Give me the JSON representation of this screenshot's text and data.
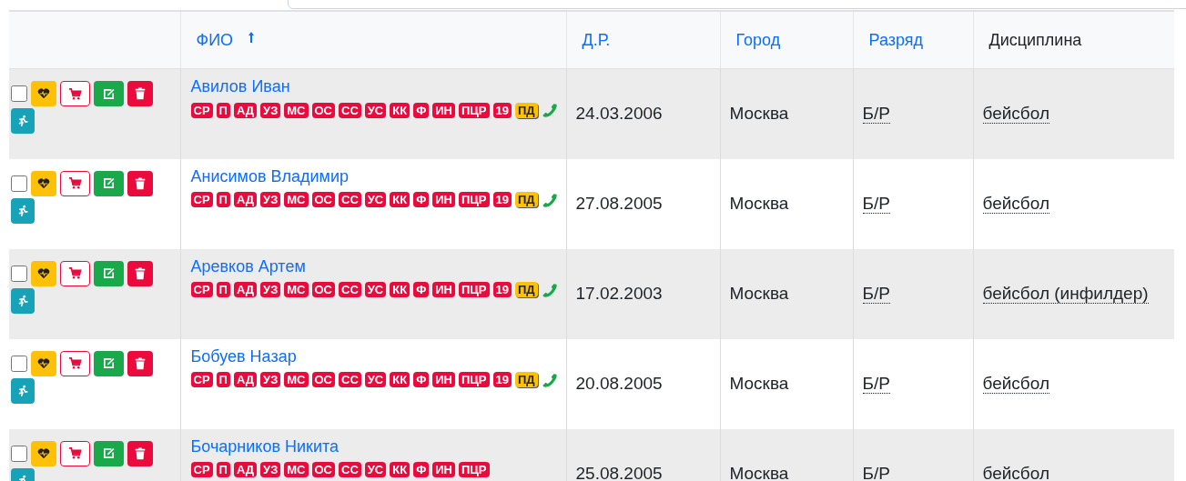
{
  "columns": [
    {
      "label": "ФИО",
      "sortable": true,
      "sorted": true
    },
    {
      "label": "Д.Р.",
      "sortable": true,
      "sorted": false
    },
    {
      "label": "Город",
      "sortable": true,
      "sorted": false
    },
    {
      "label": "Разряд",
      "sortable": true,
      "sorted": false
    },
    {
      "label": "Дисциплина",
      "sortable": false,
      "sorted": false
    }
  ],
  "rows": [
    {
      "checked": false,
      "name": "Авилов Иван",
      "badges": [
        {
          "kind": "badge",
          "text": "СР",
          "color": "#ea0a3c"
        },
        {
          "kind": "badge",
          "text": "П",
          "color": "#ea0a3c"
        },
        {
          "kind": "badge",
          "text": "АД",
          "color": "#ea0a3c"
        },
        {
          "kind": "badge",
          "text": "УЗ",
          "color": "#ea0a3c"
        },
        {
          "kind": "badge",
          "text": "МС",
          "color": "#ea0a3c"
        },
        {
          "kind": "badge",
          "text": "ОС",
          "color": "#ea0a3c"
        },
        {
          "kind": "badge",
          "text": "СС",
          "color": "#ea0a3c"
        },
        {
          "kind": "badge",
          "text": "УС",
          "color": "#ea0a3c"
        },
        {
          "kind": "badge",
          "text": "КК",
          "color": "#ea0a3c"
        },
        {
          "kind": "badge",
          "text": "Ф",
          "color": "#ea0a3c"
        },
        {
          "kind": "badge",
          "text": "ИН",
          "color": "#ea0a3c"
        },
        {
          "kind": "badge",
          "text": "ПЦР",
          "color": "#ea0a3c"
        },
        {
          "kind": "badge",
          "text": "19",
          "color": "#ea0a3c"
        },
        {
          "kind": "badge",
          "text": "ПД",
          "color": "#ffc107"
        },
        {
          "kind": "phone"
        }
      ],
      "birth": "24.03.2006",
      "city": "Москва",
      "rank": "Б/Р",
      "discipline": "бейсбол"
    },
    {
      "checked": false,
      "name": "Анисимов Владимир",
      "badges": [
        {
          "kind": "badge",
          "text": "СР",
          "color": "#ea0a3c"
        },
        {
          "kind": "badge",
          "text": "П",
          "color": "#ea0a3c"
        },
        {
          "kind": "badge",
          "text": "АД",
          "color": "#ea0a3c"
        },
        {
          "kind": "badge",
          "text": "УЗ",
          "color": "#ea0a3c"
        },
        {
          "kind": "badge",
          "text": "МС",
          "color": "#ea0a3c"
        },
        {
          "kind": "badge",
          "text": "ОС",
          "color": "#ea0a3c"
        },
        {
          "kind": "badge",
          "text": "СС",
          "color": "#ea0a3c"
        },
        {
          "kind": "badge",
          "text": "УС",
          "color": "#ea0a3c"
        },
        {
          "kind": "badge",
          "text": "КК",
          "color": "#ea0a3c"
        },
        {
          "kind": "badge",
          "text": "Ф",
          "color": "#ea0a3c"
        },
        {
          "kind": "badge",
          "text": "ИН",
          "color": "#ea0a3c"
        },
        {
          "kind": "badge",
          "text": "ПЦР",
          "color": "#ea0a3c"
        },
        {
          "kind": "badge",
          "text": "19",
          "color": "#ea0a3c"
        },
        {
          "kind": "badge",
          "text": "ПД",
          "color": "#ffc107"
        },
        {
          "kind": "phone"
        }
      ],
      "birth": "27.08.2005",
      "city": "Москва",
      "rank": "Б/Р",
      "discipline": "бейсбол"
    },
    {
      "checked": false,
      "name": "Аревков Артем",
      "badges": [
        {
          "kind": "badge",
          "text": "СР",
          "color": "#ea0a3c"
        },
        {
          "kind": "badge",
          "text": "П",
          "color": "#ea0a3c"
        },
        {
          "kind": "badge",
          "text": "АД",
          "color": "#ea0a3c"
        },
        {
          "kind": "badge",
          "text": "УЗ",
          "color": "#ea0a3c"
        },
        {
          "kind": "badge",
          "text": "МС",
          "color": "#ea0a3c"
        },
        {
          "kind": "badge",
          "text": "ОС",
          "color": "#ea0a3c"
        },
        {
          "kind": "badge",
          "text": "СС",
          "color": "#ea0a3c"
        },
        {
          "kind": "badge",
          "text": "УС",
          "color": "#ea0a3c"
        },
        {
          "kind": "badge",
          "text": "КК",
          "color": "#ea0a3c"
        },
        {
          "kind": "badge",
          "text": "Ф",
          "color": "#ea0a3c"
        },
        {
          "kind": "badge",
          "text": "ИН",
          "color": "#ea0a3c"
        },
        {
          "kind": "badge",
          "text": "ПЦР",
          "color": "#ea0a3c"
        },
        {
          "kind": "badge",
          "text": "19",
          "color": "#ea0a3c"
        },
        {
          "kind": "badge",
          "text": "ПД",
          "color": "#ffc107"
        },
        {
          "kind": "phone"
        }
      ],
      "birth": "17.02.2003",
      "city": "Москва",
      "rank": "Б/Р",
      "discipline": "бейсбол (инфилдер)"
    },
    {
      "checked": false,
      "name": "Бобуев Назар",
      "badges": [
        {
          "kind": "badge",
          "text": "СР",
          "color": "#ea0a3c"
        },
        {
          "kind": "badge",
          "text": "П",
          "color": "#ea0a3c"
        },
        {
          "kind": "badge",
          "text": "АД",
          "color": "#ea0a3c"
        },
        {
          "kind": "badge",
          "text": "УЗ",
          "color": "#ea0a3c"
        },
        {
          "kind": "badge",
          "text": "МС",
          "color": "#ea0a3c"
        },
        {
          "kind": "badge",
          "text": "ОС",
          "color": "#ea0a3c"
        },
        {
          "kind": "badge",
          "text": "СС",
          "color": "#ea0a3c"
        },
        {
          "kind": "badge",
          "text": "УС",
          "color": "#ea0a3c"
        },
        {
          "kind": "badge",
          "text": "КК",
          "color": "#ea0a3c"
        },
        {
          "kind": "badge",
          "text": "Ф",
          "color": "#ea0a3c"
        },
        {
          "kind": "badge",
          "text": "ИН",
          "color": "#ea0a3c"
        },
        {
          "kind": "badge",
          "text": "ПЦР",
          "color": "#ea0a3c"
        },
        {
          "kind": "badge",
          "text": "19",
          "color": "#ea0a3c"
        },
        {
          "kind": "badge",
          "text": "ПД",
          "color": "#ffc107"
        },
        {
          "kind": "phone"
        }
      ],
      "birth": "20.08.2005",
      "city": "Москва",
      "rank": "Б/Р",
      "discipline": "бейсбол"
    },
    {
      "checked": false,
      "name": "Бочарников Никита",
      "badges": [
        {
          "kind": "badge",
          "text": "СР",
          "color": "#ea0a3c"
        },
        {
          "kind": "badge",
          "text": "П",
          "color": "#ea0a3c"
        },
        {
          "kind": "badge",
          "text": "АД",
          "color": "#ea0a3c"
        },
        {
          "kind": "badge",
          "text": "УЗ",
          "color": "#ea0a3c"
        },
        {
          "kind": "badge",
          "text": "МС",
          "color": "#ea0a3c"
        },
        {
          "kind": "badge",
          "text": "ОС",
          "color": "#ea0a3c"
        },
        {
          "kind": "badge",
          "text": "СС",
          "color": "#ea0a3c"
        },
        {
          "kind": "badge",
          "text": "УС",
          "color": "#ea0a3c"
        },
        {
          "kind": "badge",
          "text": "КК",
          "color": "#ea0a3c"
        },
        {
          "kind": "badge",
          "text": "Ф",
          "color": "#ea0a3c"
        },
        {
          "kind": "badge",
          "text": "ИН",
          "color": "#ea0a3c"
        },
        {
          "kind": "badge",
          "text": "ПЦР",
          "color": "#ea0a3c"
        }
      ],
      "birth": "25.08.2005",
      "city": "Москва",
      "rank": "Б/Р",
      "discipline": "бейсбол"
    }
  ]
}
